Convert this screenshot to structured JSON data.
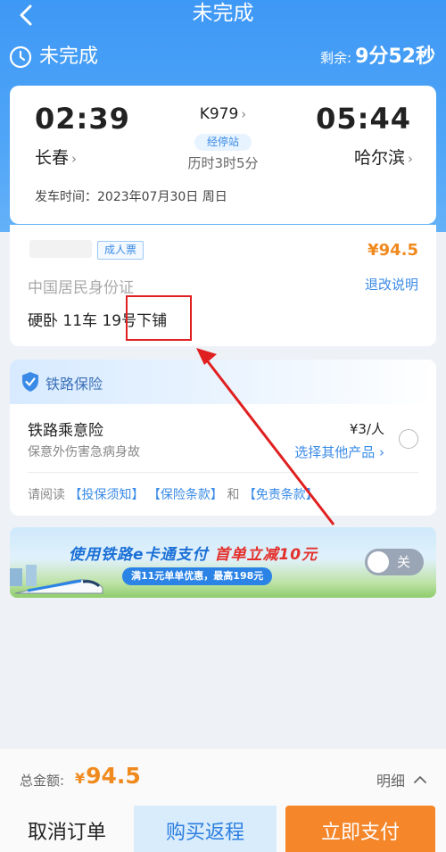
{
  "nav": {
    "title": "未完成"
  },
  "status": {
    "label": "未完成",
    "remain_label": "剩余:",
    "remain_value": "9分52秒"
  },
  "train": {
    "dep_time": "02:39",
    "dep_city": "长春",
    "number": "K979",
    "stops_badge": "经停站",
    "duration": "历时3时5分",
    "arr_time": "05:44",
    "arr_city": "哈尔滨",
    "depart_date": "发车时间：2023年07月30日 周日"
  },
  "passenger": {
    "ticket_type": "成人票",
    "price": "¥94.5",
    "id_type": "中国居民身份证",
    "refund": "退改说明",
    "seat": "硬卧 11车 19号下铺"
  },
  "insurance": {
    "section_title": "铁路保险",
    "name": "铁路乘意险",
    "price": "¥3/人",
    "desc": "保意外伤害急病身故",
    "other": "选择其他产品",
    "terms_prefix": "请阅读",
    "terms_1": "【投保须知】",
    "terms_2": "【保险条款】",
    "terms_and": "和",
    "terms_3": "【免责条款】"
  },
  "banner": {
    "title_a": "使用铁路",
    "title_b": "e卡通支付",
    "title_c": "首单立减10元",
    "subtitle": "满11元单单优惠，最高198元",
    "toggle_label": "关",
    "toggle_on": false
  },
  "footer": {
    "total_label": "总金额:",
    "total_yen": "¥",
    "total_value": "94.5",
    "detail": "明细",
    "cancel": "取消订单",
    "return_trip": "购买返程",
    "pay": "立即支付"
  },
  "colors": {
    "primary": "#3e98f5",
    "accent_orange": "#f5862a",
    "price_orange": "#f08a1f",
    "annotation_red": "#e02020"
  },
  "icons": [
    "back-arrow-icon",
    "clock-icon",
    "shield-icon",
    "chevron-right-icon",
    "chevron-up-icon",
    "train-illustration"
  ]
}
